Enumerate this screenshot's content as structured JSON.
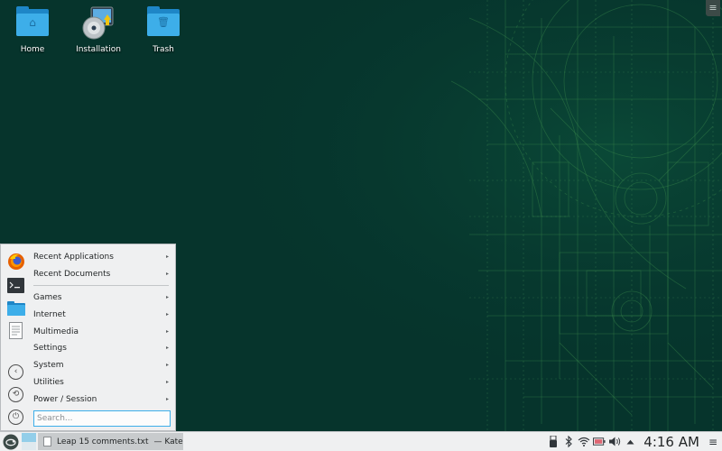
{
  "desktop": {
    "icons": [
      {
        "label": "Home",
        "icon": "folder-home-icon"
      },
      {
        "label": "Installation",
        "icon": "installation-disc-icon"
      },
      {
        "label": "Trash",
        "icon": "trash-folder-icon"
      }
    ],
    "colors": {
      "wallpaper": "#06342c",
      "accent": "#3daee9",
      "circuit": "#2d7a4a"
    }
  },
  "launcher": {
    "favorites": [
      "firefox-icon",
      "terminal-icon",
      "file-manager-icon",
      "text-editor-icon"
    ],
    "system_actions": [
      "logout-icon",
      "switch-user-icon",
      "shutdown-icon"
    ],
    "menu_items": [
      {
        "label": "Recent Applications",
        "has_submenu": true
      },
      {
        "label": "Recent Documents",
        "has_submenu": true
      },
      {
        "label": "Games",
        "has_submenu": true
      },
      {
        "label": "Internet",
        "has_submenu": true
      },
      {
        "label": "Multimedia",
        "has_submenu": true
      },
      {
        "label": "Settings",
        "has_submenu": true
      },
      {
        "label": "System",
        "has_submenu": true
      },
      {
        "label": "Utilities",
        "has_submenu": true
      },
      {
        "label": "Power / Session",
        "has_submenu": true
      }
    ],
    "arrow": "▸",
    "search": {
      "placeholder": "Search...",
      "value": ""
    }
  },
  "taskbar": {
    "task": {
      "title": "Leap 15 comments.txt",
      "app": "— Kate"
    },
    "tray_icons": [
      "usb-device-icon",
      "bluetooth-icon",
      "wifi-icon",
      "battery-icon",
      "volume-icon",
      "expand-arrow-icon"
    ],
    "clock": "4:16 AM",
    "menu_glyph": "≡"
  },
  "toolbox": {
    "glyph": "≡"
  }
}
